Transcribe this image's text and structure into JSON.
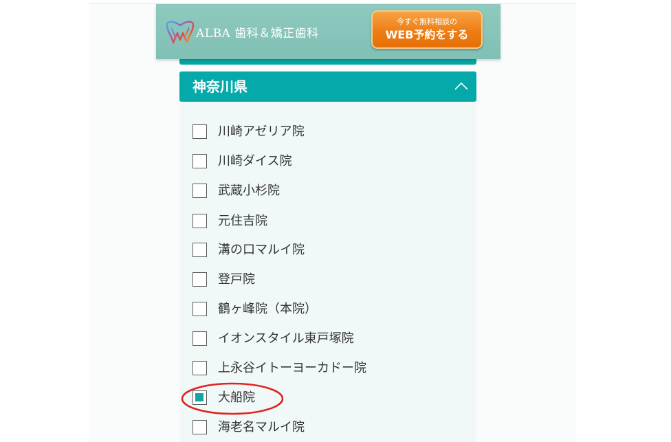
{
  "header": {
    "brand": "ALBA 歯科＆矯正歯科",
    "logo_icon": "alba-tooth-logo-icon",
    "cta": {
      "small": "今すぐ無料相談の",
      "big": "WEB予約をする"
    }
  },
  "section": {
    "title": "神奈川県",
    "expanded": true,
    "chevron_icon": "chevron-up-icon"
  },
  "clinics": [
    {
      "label": "川崎アゼリア院",
      "checked": false
    },
    {
      "label": "川崎ダイス院",
      "checked": false
    },
    {
      "label": "武蔵小杉院",
      "checked": false
    },
    {
      "label": "元住吉院",
      "checked": false
    },
    {
      "label": "溝の口マルイ院",
      "checked": false
    },
    {
      "label": "登戸院",
      "checked": false
    },
    {
      "label": "鶴ヶ峰院（本院）",
      "checked": false
    },
    {
      "label": "イオンスタイル東戸塚院",
      "checked": false
    },
    {
      "label": "上永谷イトーヨーカドー院",
      "checked": false
    },
    {
      "label": "大船院",
      "checked": true
    },
    {
      "label": "海老名マルイ院",
      "checked": false
    }
  ],
  "colors": {
    "teal": "#05a9a9",
    "header_bg": "#8fc9be",
    "cta_orange": "#ee7e14",
    "highlight_red": "#e0231c"
  }
}
